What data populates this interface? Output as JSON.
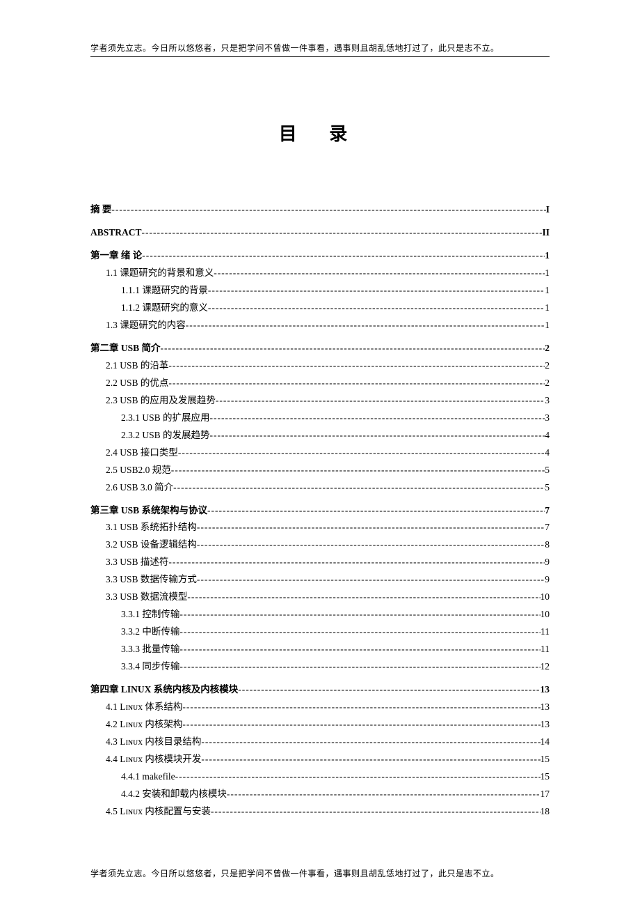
{
  "header_quote": "学者须先立志。今日所以悠悠者，只是把学问不曾做一件事看，遇事则且胡乱恁地打过了，此只是志不立。",
  "footer_quote": "学者须先立志。今日所以悠悠者，只是把学问不曾做一件事看，遇事则且胡乱恁地打过了，此只是志不立。",
  "title": "目  录",
  "toc": [
    {
      "level": 0,
      "label": "摘    要",
      "page": "I"
    },
    {
      "level": 0,
      "label": "ABSTRACT",
      "page": "II"
    },
    {
      "level": 0,
      "label": "第一章     绪  论",
      "page": "1"
    },
    {
      "level": 1,
      "label": "1.1 课题研究的背景和意义",
      "page": "1"
    },
    {
      "level": 2,
      "label": "1.1.1 课题研究的背景",
      "page": "1"
    },
    {
      "level": 2,
      "label": "1.1.2 课题研究的意义",
      "page": "1"
    },
    {
      "level": 1,
      "label": "1.3 课题研究的内容",
      "page": "1"
    },
    {
      "level": 0,
      "label": "第二章      USB 简介",
      "page": "2"
    },
    {
      "level": 1,
      "label": "2.1 USB 的沿革",
      "page": "2"
    },
    {
      "level": 1,
      "label": "2.2 USB 的优点",
      "page": "2"
    },
    {
      "level": 1,
      "label": "2.3 USB 的应用及发展趋势",
      "page": "3"
    },
    {
      "level": 2,
      "label": "2.3.1 USB 的扩展应用",
      "page": "3"
    },
    {
      "level": 2,
      "label": "2.3.2 USB 的发展趋势",
      "page": "4"
    },
    {
      "level": 1,
      "label": "2.4 USB 接口类型",
      "page": "4"
    },
    {
      "level": 1,
      "label": "2.5 USB2.0 规范",
      "page": "5"
    },
    {
      "level": 1,
      "label": "2.6 USB 3.0 简介",
      "page": "5"
    },
    {
      "level": 0,
      "label": "第三章      USB 系统架构与协议",
      "page": "7"
    },
    {
      "level": 1,
      "label": "3.1 USB 系统拓扑结构",
      "page": "7"
    },
    {
      "level": 1,
      "label": "3.2 USB 设备逻辑结构",
      "page": "8"
    },
    {
      "level": 1,
      "label": "3.3 USB 描述符",
      "page": "9"
    },
    {
      "level": 1,
      "label": "3.3 USB 数据传输方式",
      "page": "9"
    },
    {
      "level": 1,
      "label": "3.3 USB 数据流模型",
      "page": "10"
    },
    {
      "level": 2,
      "label": "3.3.1 控制传输",
      "page": "10"
    },
    {
      "level": 2,
      "label": "3.3.2 中断传输",
      "page": "11"
    },
    {
      "level": 2,
      "label": "3.3.3 批量传输",
      "page": "11"
    },
    {
      "level": 2,
      "label": "3.3.4 同步传输",
      "page": "12"
    },
    {
      "level": 0,
      "label": "第四章      LINUX 系统内核及内核模块",
      "page": "13"
    },
    {
      "level": 1,
      "label": "4.1 Lɪɴᴜx 体系结构",
      "page": "13"
    },
    {
      "level": 1,
      "label": "4.2 Lɪɴᴜx 内核架构",
      "page": "13"
    },
    {
      "level": 1,
      "label": "4.3 Lɪɴᴜx 内核目录结构",
      "page": "14"
    },
    {
      "level": 1,
      "label": "4.4 Lɪɴᴜx 内核模块开发",
      "page": "15"
    },
    {
      "level": 2,
      "label": "4.4.1 makefile",
      "page": "15"
    },
    {
      "level": 2,
      "label": "4.4.2 安装和卸载内核模块",
      "page": "17"
    },
    {
      "level": 1,
      "label": "4.5 Lɪɴᴜx 内核配置与安装",
      "page": "18"
    }
  ]
}
